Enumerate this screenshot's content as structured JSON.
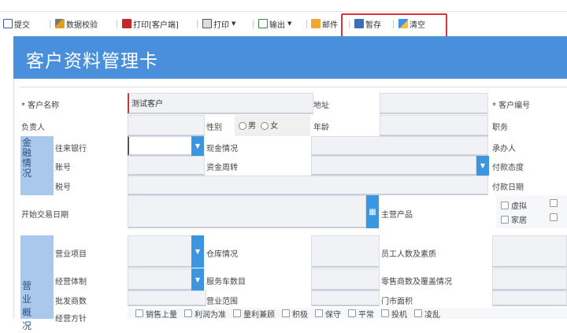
{
  "toolbar": {
    "submit": "提交",
    "validate": "数据校验",
    "print_client": "打印[客户端]",
    "print": "打印",
    "export": "输出",
    "mail": "邮件",
    "save_draft": "暂存",
    "clear": "清空"
  },
  "header": {
    "title": "客户资料管理卡"
  },
  "form": {
    "customer_name_label": "* 客户名称",
    "customer_name_value": "测试客户",
    "address_label": "地址",
    "customer_no_label": "* 客户编号",
    "owner_label": "负责人",
    "gender_label": "性别",
    "male": "男",
    "female": "女",
    "age_label": "年龄",
    "position_label": "职务",
    "finance_section": "金融情况",
    "bank_label": "往来银行",
    "cash_label": "现金情况",
    "handler_label": "承办人",
    "account_label": "账号",
    "fund_label": "资金周转",
    "pay_attitude_label": "付款态度",
    "tax_label": "税号",
    "pay_date_label": "付款日期",
    "start_date_label": "开始交易日期",
    "main_product_label": "主营产品",
    "products": [
      "虚拟",
      "家居"
    ],
    "business_section": "营业概况",
    "business_item_label": "营业项目",
    "warehouse_label": "仓库情况",
    "staff_label": "员工人数及素质",
    "system_label": "经营体制",
    "service_car_label": "服务车数目",
    "retailer_label": "零售商数及覆盖情况",
    "wholesaler_label": "批发商数",
    "scope_label": "营业范围",
    "store_area_label": "门市面积",
    "policy_label": "经营方针",
    "policies": [
      "销售上量",
      "利润为准",
      "量利兼顾",
      "积极",
      "保守",
      "平常",
      "投机",
      "凌乱"
    ]
  },
  "colors": {
    "header": "#4a8fdc",
    "accent": "#3d95e0",
    "section": "#a9c8ec",
    "highlight": "#d33333"
  }
}
